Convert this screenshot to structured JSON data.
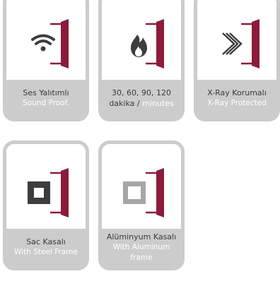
{
  "cards": [
    {
      "icon": "wifi-icon",
      "title_tr": "Ses Yalıtımlı",
      "title_en": "Sound Proof."
    },
    {
      "icon": "fire-icon",
      "title_tr": "30, 60, 90, 120",
      "title_tr_line2": "dakika",
      "separator": "/",
      "title_en": "minutes"
    },
    {
      "icon": "xray-chevron-icon",
      "title_tr": "X-Ray Korumalı",
      "title_en": "X-Ray Protected"
    },
    {
      "icon": "steel-frame-icon",
      "title_tr": "Sac Kasalı",
      "title_en": "With Steel Frame"
    },
    {
      "icon": "aluminum-frame-icon",
      "title_tr": "Alüminyum Kasalı",
      "title_en": "With Aluminum frame"
    }
  ],
  "colors": {
    "door": "#8b1c3c",
    "icon_dark": "#3d3d3d",
    "icon_light": "#a6a6a6",
    "card_border": "#cccccc",
    "caption_text": "#3a3a3a",
    "caption_en": "#ffffff"
  }
}
